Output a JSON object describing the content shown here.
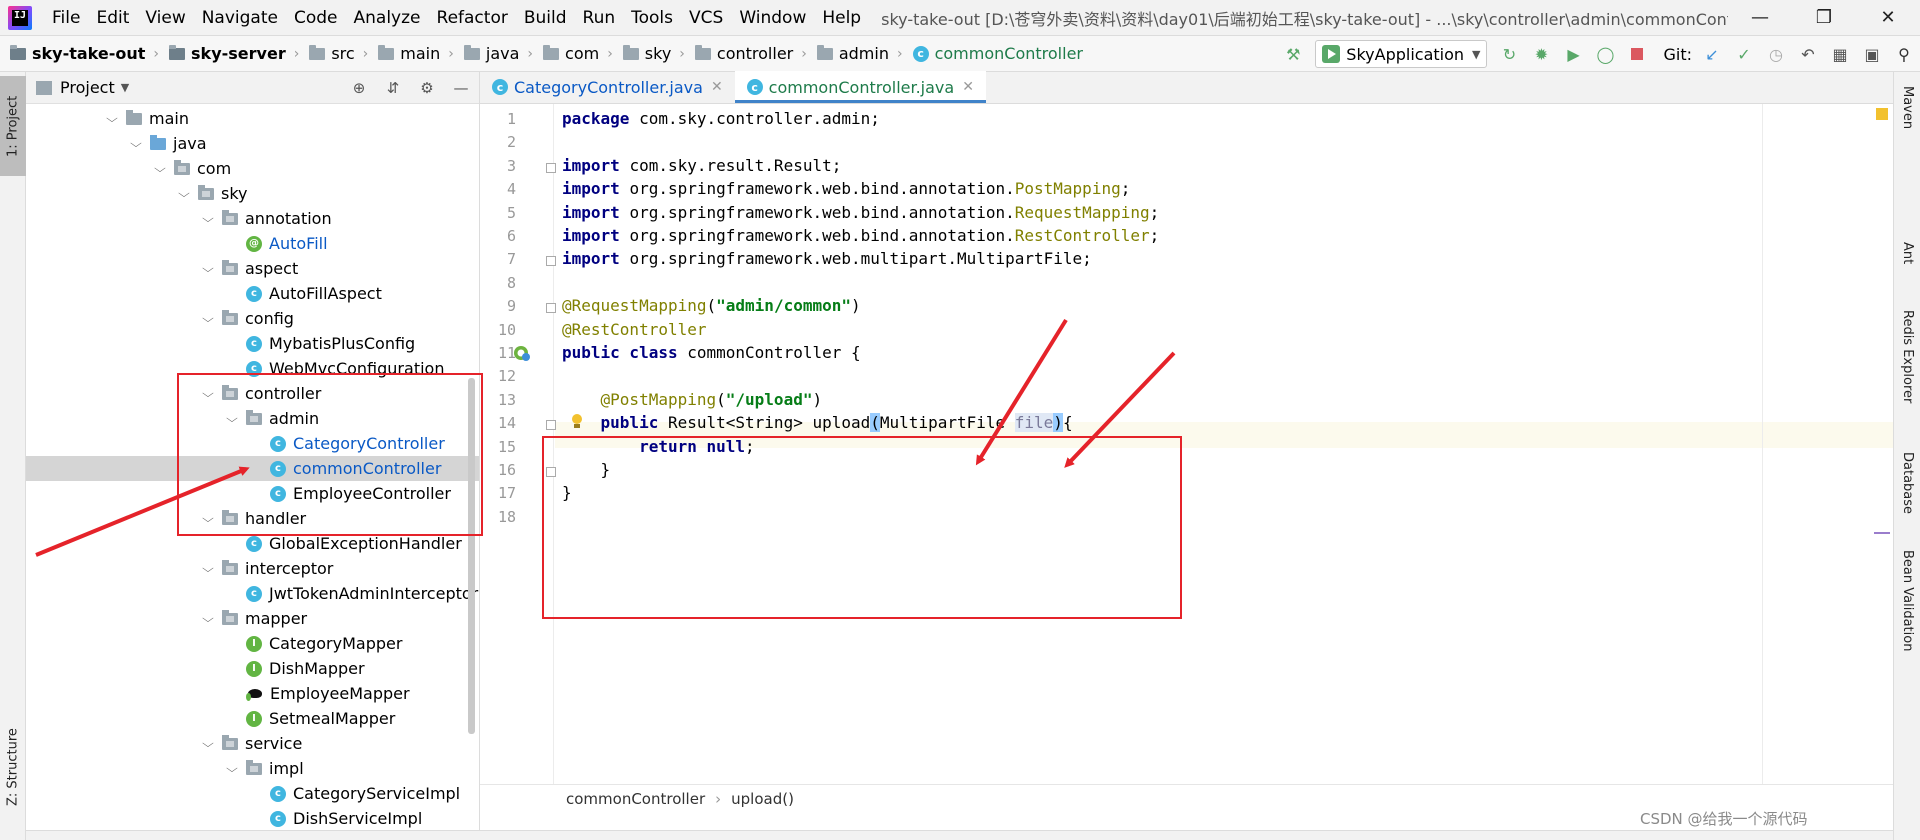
{
  "menubar": {
    "items": [
      "File",
      "Edit",
      "View",
      "Navigate",
      "Code",
      "Analyze",
      "Refactor",
      "Build",
      "Run",
      "Tools",
      "VCS",
      "Window",
      "Help"
    ],
    "title": "sky-take-out [D:\\苍穹外卖\\资料\\资料\\day01\\后端初始工程\\sky-take-out] - ...\\sky\\controller\\admin\\commonController.java [sky-server]"
  },
  "navbar": {
    "crumbs": [
      "sky-take-out",
      "sky-server",
      "src",
      "main",
      "java",
      "com",
      "sky",
      "controller",
      "admin",
      "commonController"
    ],
    "run_config": "SkyApplication",
    "git_label": "Git:"
  },
  "left_strip": {
    "project_tab": "1: Project",
    "structure_tab": "Z: Structure"
  },
  "project_panel": {
    "title": "Project",
    "tree": [
      {
        "label": "main",
        "kind": "folder",
        "depth": 0,
        "arrow": "down"
      },
      {
        "label": "java",
        "kind": "src-folder",
        "depth": 1,
        "arrow": "down"
      },
      {
        "label": "com",
        "kind": "package",
        "depth": 2,
        "arrow": "down"
      },
      {
        "label": "sky",
        "kind": "package",
        "depth": 3,
        "arrow": "down"
      },
      {
        "label": "annotation",
        "kind": "package",
        "depth": 4,
        "arrow": "down"
      },
      {
        "label": "AutoFill",
        "kind": "annotation",
        "depth": 5,
        "arrow": "",
        "blue": true
      },
      {
        "label": "aspect",
        "kind": "package",
        "depth": 4,
        "arrow": "down"
      },
      {
        "label": "AutoFillAspect",
        "kind": "class",
        "depth": 5,
        "arrow": ""
      },
      {
        "label": "config",
        "kind": "package",
        "depth": 4,
        "arrow": "down"
      },
      {
        "label": "MybatisPlusConfig",
        "kind": "class",
        "depth": 5,
        "arrow": ""
      },
      {
        "label": "WebMvcConfiguration",
        "kind": "class",
        "depth": 5,
        "arrow": ""
      },
      {
        "label": "controller",
        "kind": "package",
        "depth": 4,
        "arrow": "down"
      },
      {
        "label": "admin",
        "kind": "package",
        "depth": 5,
        "arrow": "down"
      },
      {
        "label": "CategoryController",
        "kind": "class",
        "depth": 6,
        "arrow": "",
        "blue": true
      },
      {
        "label": "commonController",
        "kind": "class",
        "depth": 6,
        "arrow": "",
        "blue": true,
        "selected": true
      },
      {
        "label": "EmployeeController",
        "kind": "class",
        "depth": 6,
        "arrow": ""
      },
      {
        "label": "handler",
        "kind": "package",
        "depth": 4,
        "arrow": "down"
      },
      {
        "label": "GlobalExceptionHandler",
        "kind": "class",
        "depth": 5,
        "arrow": ""
      },
      {
        "label": "interceptor",
        "kind": "package",
        "depth": 4,
        "arrow": "down"
      },
      {
        "label": "JwtTokenAdminInterceptor",
        "kind": "class",
        "depth": 5,
        "arrow": ""
      },
      {
        "label": "mapper",
        "kind": "package",
        "depth": 4,
        "arrow": "down"
      },
      {
        "label": "CategoryMapper",
        "kind": "interface",
        "depth": 5,
        "arrow": ""
      },
      {
        "label": "DishMapper",
        "kind": "interface",
        "depth": 5,
        "arrow": ""
      },
      {
        "label": "EmployeeMapper",
        "kind": "mybatis",
        "depth": 5,
        "arrow": ""
      },
      {
        "label": "SetmealMapper",
        "kind": "interface",
        "depth": 5,
        "arrow": ""
      },
      {
        "label": "service",
        "kind": "package",
        "depth": 4,
        "arrow": "down"
      },
      {
        "label": "impl",
        "kind": "package",
        "depth": 5,
        "arrow": "down"
      },
      {
        "label": "CategoryServiceImpl",
        "kind": "class",
        "depth": 6,
        "arrow": ""
      },
      {
        "label": "DishServiceImpl",
        "kind": "class",
        "depth": 6,
        "arrow": ""
      }
    ]
  },
  "editor": {
    "tabs": [
      {
        "label": "CategoryController.java",
        "active": false
      },
      {
        "label": "commonController.java",
        "active": true
      }
    ],
    "lines": [
      [
        {
          "t": "package ",
          "c": "kw"
        },
        {
          "t": "com.sky.controller.admin;",
          "c": "plain"
        }
      ],
      [],
      [
        {
          "t": "import ",
          "c": "kw"
        },
        {
          "t": "com.sky.result.Result;",
          "c": "plain"
        }
      ],
      [
        {
          "t": "import ",
          "c": "kw"
        },
        {
          "t": "org.springframework.web.bind.annotation.",
          "c": "plain"
        },
        {
          "t": "PostMapping",
          "c": "anno"
        },
        {
          "t": ";",
          "c": "plain"
        }
      ],
      [
        {
          "t": "import ",
          "c": "kw"
        },
        {
          "t": "org.springframework.web.bind.annotation.",
          "c": "plain"
        },
        {
          "t": "RequestMapping",
          "c": "anno"
        },
        {
          "t": ";",
          "c": "plain"
        }
      ],
      [
        {
          "t": "import ",
          "c": "kw"
        },
        {
          "t": "org.springframework.web.bind.annotation.",
          "c": "plain"
        },
        {
          "t": "RestController",
          "c": "anno"
        },
        {
          "t": ";",
          "c": "plain"
        }
      ],
      [
        {
          "t": "import ",
          "c": "kw"
        },
        {
          "t": "org.springframework.web.multipart.MultipartFile;",
          "c": "plain"
        }
      ],
      [],
      [
        {
          "t": "@RequestMapping",
          "c": "anno"
        },
        {
          "t": "(",
          "c": "plain"
        },
        {
          "t": "\"admin/common\"",
          "c": "str"
        },
        {
          "t": ")",
          "c": "plain"
        }
      ],
      [
        {
          "t": "@RestController",
          "c": "anno"
        }
      ],
      [
        {
          "t": "public class ",
          "c": "kw"
        },
        {
          "t": "commonController {",
          "c": "plain"
        }
      ],
      [],
      [
        {
          "t": "    ",
          "c": "plain"
        },
        {
          "t": "@PostMapping",
          "c": "anno"
        },
        {
          "t": "(",
          "c": "plain"
        },
        {
          "t": "\"/upload\"",
          "c": "str"
        },
        {
          "t": ")",
          "c": "plain"
        }
      ],
      [
        {
          "t": "    ",
          "c": "plain"
        },
        {
          "t": "public ",
          "c": "kw"
        },
        {
          "t": "Result<String> upload",
          "c": "plain"
        },
        {
          "t": "(",
          "c": "brace-hl"
        },
        {
          "t": "MultipartFile ",
          "c": "plain"
        },
        {
          "t": "file",
          "c": "param"
        },
        {
          "t": ")",
          "c": "brace-hl"
        },
        {
          "t": "{",
          "c": "plain"
        }
      ],
      [
        {
          "t": "        ",
          "c": "plain"
        },
        {
          "t": "return null",
          "c": "kw"
        },
        {
          "t": ";",
          "c": "plain"
        }
      ],
      [
        {
          "t": "    }",
          "c": "plain"
        }
      ],
      [
        {
          "t": "}",
          "c": "plain"
        }
      ],
      []
    ],
    "breadcrumb": [
      "commonController",
      "upload()"
    ]
  },
  "right_strip": {
    "tabs": [
      "Maven",
      "Ant",
      "Redis Explorer",
      "Database",
      "Bean Validation"
    ]
  },
  "watermark": "CSDN @给我一个源代码",
  "colors": {
    "annotation_red": "#e5232a",
    "keyword": "#000080",
    "string": "#067d17",
    "annotation": "#808000"
  }
}
